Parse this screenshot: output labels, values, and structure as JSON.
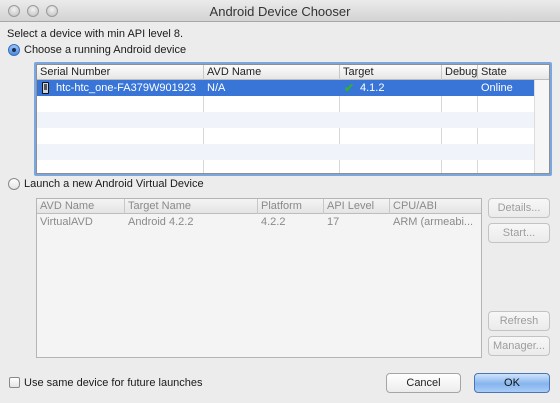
{
  "window": {
    "title": "Android Device Chooser"
  },
  "prompt": "Select a device with min API level 8.",
  "running": {
    "radio_label": "Choose a running Android device",
    "columns": [
      "Serial Number",
      "AVD Name",
      "Target",
      "Debug",
      "State"
    ],
    "rows": [
      {
        "serial": "htc-htc_one-FA379W901923",
        "avd": "N/A",
        "target": "4.1.2",
        "debug": "",
        "state": "Online",
        "target_icon": "check-icon",
        "device_icon": "phone-icon"
      }
    ]
  },
  "launch": {
    "radio_label": "Launch a new Android Virtual Device",
    "columns": [
      "AVD Name",
      "Target Name",
      "Platform",
      "API Level",
      "CPU/ABI"
    ],
    "rows": [
      {
        "name": "VirtualAVD",
        "target": "Android 4.2.2",
        "platform": "4.2.2",
        "api": "17",
        "cpu": "ARM (armeabi..."
      }
    ],
    "buttons": {
      "details": "Details...",
      "start": "Start...",
      "refresh": "Refresh",
      "manager": "Manager..."
    }
  },
  "footer": {
    "checkbox_label": "Use same device for future launches",
    "cancel": "Cancel",
    "ok": "OK"
  },
  "colors": {
    "selection": "#3875d7",
    "default_button": "#85b4ee",
    "check": "#2fb32f"
  }
}
